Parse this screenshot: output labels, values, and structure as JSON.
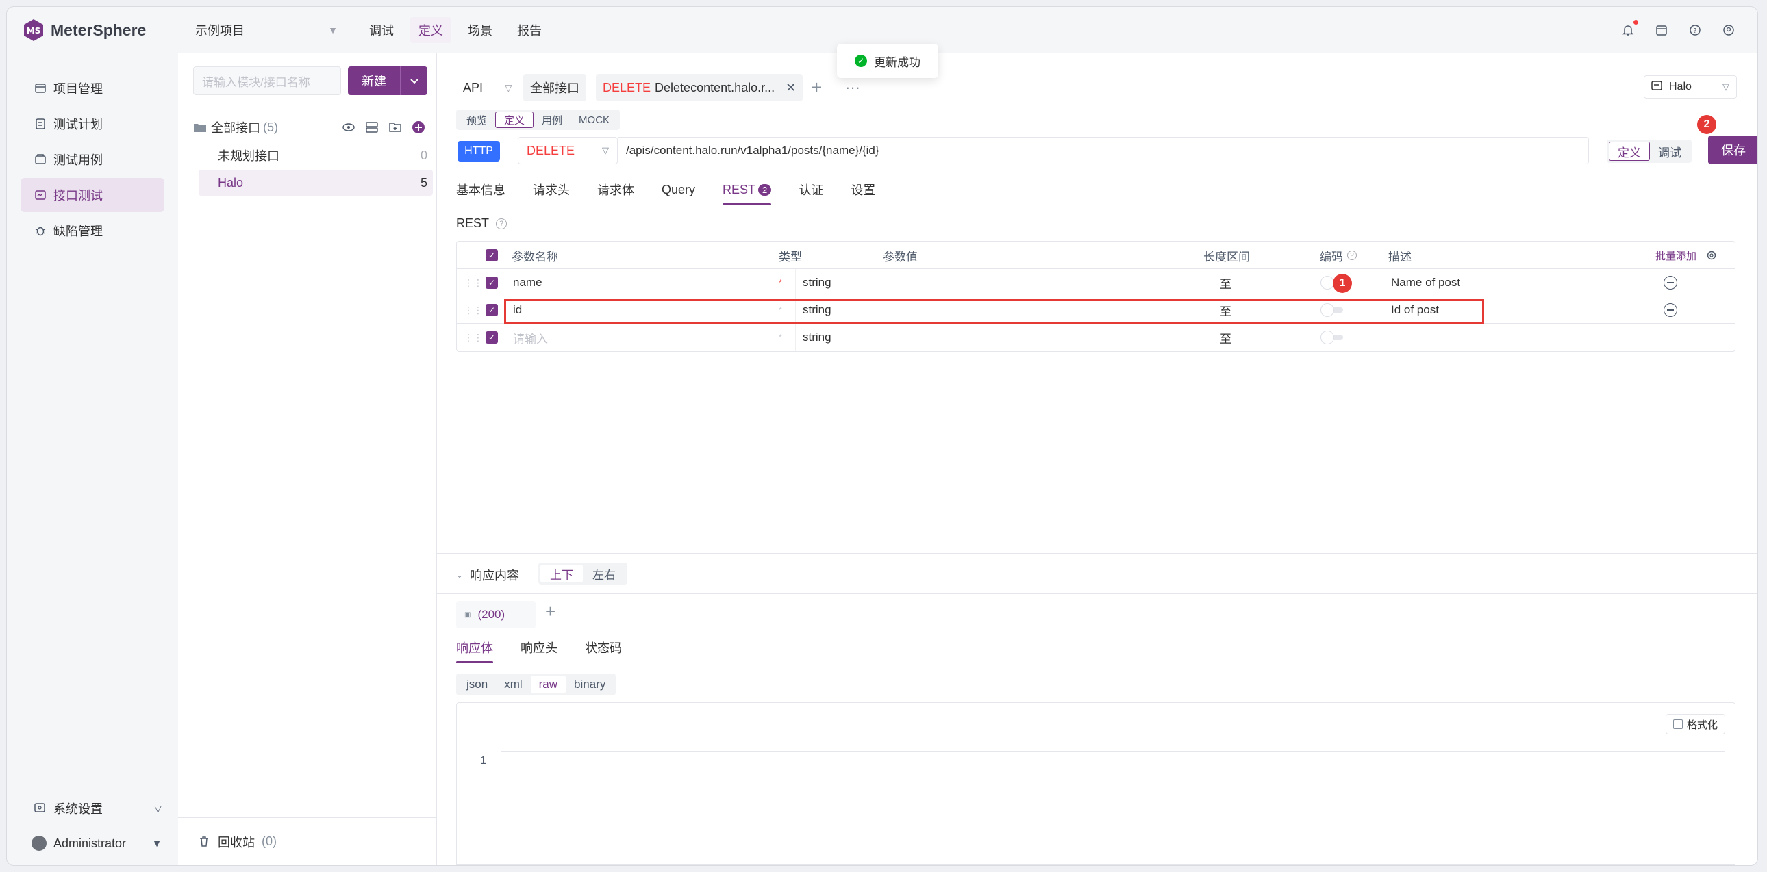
{
  "app": {
    "name": "MeterSphere",
    "project": "示例项目",
    "topnav": [
      {
        "label": "调试",
        "active": false
      },
      {
        "label": "定义",
        "active": true
      },
      {
        "label": "场景",
        "active": false
      },
      {
        "label": "报告",
        "active": false
      }
    ],
    "toolbar_icons": [
      "bell-icon",
      "calendar-icon",
      "help-icon",
      "user-settings-icon"
    ],
    "accent": "#783887"
  },
  "sidebar": {
    "items": [
      {
        "label": "项目管理",
        "icon": "project-icon",
        "active": false
      },
      {
        "label": "测试计划",
        "icon": "plan-icon",
        "active": false
      },
      {
        "label": "测试用例",
        "icon": "case-icon",
        "active": false
      },
      {
        "label": "接口测试",
        "icon": "api-icon",
        "active": true
      },
      {
        "label": "缺陷管理",
        "icon": "bug-icon",
        "active": false
      }
    ],
    "system_settings": "系统设置",
    "user": "Administrator"
  },
  "module_panel": {
    "search_placeholder": "请输入模块/接口名称",
    "new_button": "新建",
    "root_label": "全部接口",
    "root_count": "(5)",
    "nodes": [
      {
        "label": "未规划接口",
        "count": "0",
        "active": false
      },
      {
        "label": "Halo",
        "count": "5",
        "active": true
      }
    ],
    "recycle_label": "回收站",
    "recycle_count": "(0)"
  },
  "tabs": {
    "api_label": "API",
    "all_label": "全部接口",
    "active_method": "DELETE",
    "active_name": "Deletecontent.halo.r...",
    "more": "···"
  },
  "environment": {
    "selected": "Halo"
  },
  "toast": {
    "text": "更新成功"
  },
  "mode_tabs": [
    {
      "label": "预览",
      "active": false
    },
    {
      "label": "定义",
      "active": true
    },
    {
      "label": "用例",
      "active": false
    },
    {
      "label": "MOCK",
      "active": false
    }
  ],
  "request": {
    "protocol": "HTTP",
    "method": "DELETE",
    "url": "/apis/content.halo.run/v1alpha1/posts/{name}/{id}",
    "mode_toggle": [
      {
        "label": "定义",
        "active": true
      },
      {
        "label": "调试",
        "active": false
      }
    ],
    "save_label": "保存"
  },
  "badges": {
    "one": "1",
    "two": "2"
  },
  "sub_tabs": [
    {
      "label": "基本信息",
      "active": false
    },
    {
      "label": "请求头",
      "active": false
    },
    {
      "label": "请求体",
      "active": false
    },
    {
      "label": "Query",
      "active": false
    },
    {
      "label": "REST",
      "active": true,
      "count": "2"
    },
    {
      "label": "认证",
      "active": false
    },
    {
      "label": "设置",
      "active": false
    }
  ],
  "rest": {
    "title": "REST",
    "headers": {
      "name": "参数名称",
      "type": "类型",
      "value": "参数值",
      "length": "长度区间",
      "encode": "编码",
      "desc": "描述",
      "batch": "批量添加"
    },
    "rows": [
      {
        "name": "name",
        "type": "string",
        "length": "至",
        "desc": "Name of post"
      },
      {
        "name": "id",
        "type": "string",
        "length": "至",
        "desc": "Id of post"
      }
    ],
    "new_row": {
      "placeholder": "请输入",
      "type": "string",
      "length": "至"
    }
  },
  "response": {
    "title": "响应内容",
    "layout": [
      {
        "label": "上下",
        "active": true
      },
      {
        "label": "左右",
        "active": false
      }
    ],
    "code_tab": "(200)",
    "tabs": [
      {
        "label": "响应体",
        "active": true
      },
      {
        "label": "响应头",
        "active": false
      },
      {
        "label": "状态码",
        "active": false
      }
    ],
    "formats": [
      {
        "label": "json",
        "active": false
      },
      {
        "label": "xml",
        "active": false
      },
      {
        "label": "raw",
        "active": true
      },
      {
        "label": "binary",
        "active": false
      }
    ],
    "format_button": "格式化",
    "line_number": "1"
  }
}
